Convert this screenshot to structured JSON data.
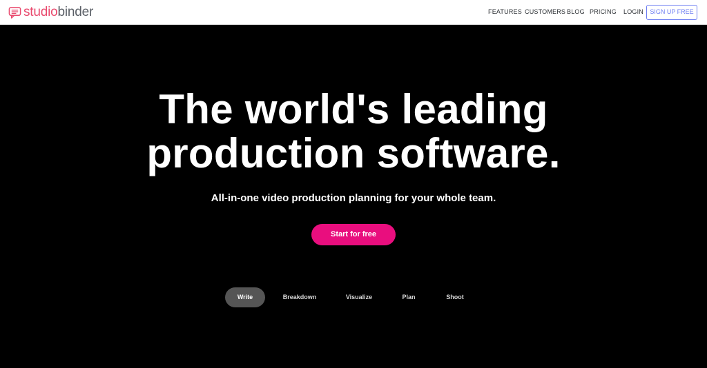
{
  "brand": {
    "name_part1": "studio",
    "name_part2": "binder",
    "primary_color": "#e94a6e",
    "secondary_color": "#5a5f66",
    "icon": "chat-bubble-logo-icon"
  },
  "nav": {
    "features": "FEATURES",
    "customers": "CUSTOMERS",
    "blog": "BLOG",
    "pricing": "PRICING",
    "login": "LOGIN",
    "signup": "SIGN UP FREE",
    "signup_color": "#6c7cf2"
  },
  "hero": {
    "headline_line1": "The world's leading",
    "headline_line2": "production software.",
    "subheadline": "All-in-one video production planning for your whole team.",
    "cta": "Start for free",
    "cta_color": "#e90e7e",
    "background": "#000000"
  },
  "tabs": {
    "active": "Write",
    "items": [
      {
        "label": "Write"
      },
      {
        "label": "Breakdown"
      },
      {
        "label": "Visualize"
      },
      {
        "label": "Plan"
      },
      {
        "label": "Shoot"
      }
    ]
  }
}
